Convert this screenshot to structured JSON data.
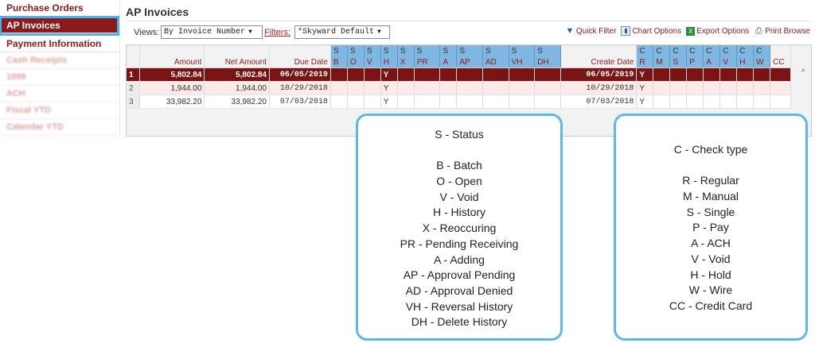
{
  "sidebar": {
    "items": [
      {
        "label": "Purchase Orders",
        "state": "normal"
      },
      {
        "label": "AP Invoices",
        "state": "active"
      },
      {
        "label": "Payment Information",
        "state": "normal"
      },
      {
        "label": "Cash Receipts",
        "state": "blurred"
      },
      {
        "label": "1099",
        "state": "blurred"
      },
      {
        "label": "ACH",
        "state": "blurred"
      },
      {
        "label": "Fiscal YTD",
        "state": "blurred"
      },
      {
        "label": "Calendar YTD",
        "state": "blurred"
      }
    ]
  },
  "page": {
    "title": "AP Invoices"
  },
  "toolbar": {
    "views_label": "Views:",
    "views_value": "By Invoice Number",
    "filters_label": "Filters:",
    "filters_value": "*Skyward Default",
    "quick_filter": "Quick Filter",
    "chart_options": "Chart Options",
    "export_options": "Export Options",
    "print_browse": "Print Browse"
  },
  "grid": {
    "columns": {
      "amount": "Amount",
      "net_amount": "Net Amount",
      "due_date": "Due Date",
      "create_date": "Create Date",
      "status_group": [
        "S",
        "S",
        "S",
        "S",
        "S",
        "S",
        "S",
        "S",
        "S",
        "S",
        "S"
      ],
      "status_codes": [
        "B",
        "O",
        "V",
        "H",
        "X",
        "PR",
        "A",
        "AP",
        "AD",
        "VH",
        "DH"
      ],
      "check_group": [
        "C",
        "C",
        "C",
        "C",
        "C",
        "C",
        "C",
        "C"
      ],
      "check_codes": [
        "R",
        "M",
        "S",
        "P",
        "A",
        "V",
        "H",
        "W",
        "CC"
      ]
    },
    "rows": [
      {
        "num": "1",
        "amount": "5,802.84",
        "net": "5,802.84",
        "due": "06/05/2019",
        "h": "Y",
        "create": "06/05/2019",
        "r": "Y"
      },
      {
        "num": "2",
        "amount": "1,944.00",
        "net": "1,944.00",
        "due": "10/29/2018",
        "h": "Y",
        "create": "10/29/2018",
        "r": "Y"
      },
      {
        "num": "3",
        "amount": "33,982.20",
        "net": "33,982.20",
        "due": "07/03/2018",
        "h": "Y",
        "create": "07/03/2018",
        "r": "Y"
      }
    ]
  },
  "status_legend": {
    "title": "S - Status",
    "items": [
      "B - Batch",
      "O - Open",
      "V - Void",
      "H - History",
      "X - Reoccuring",
      "PR - Pending Receiving",
      "A - Adding",
      "AP - Approval Pending",
      "AD - Approval Denied",
      "VH - Reversal History",
      "DH - Delete History"
    ]
  },
  "check_legend": {
    "title": "C - Check type",
    "items": [
      "R - Regular",
      "M - Manual",
      "S - Single",
      "P - Pay",
      "A - ACH",
      "V - Void",
      "H - Hold",
      "W - Wire",
      "CC - Credit Card"
    ]
  },
  "colors": {
    "brand": "#8b1a1a",
    "accent": "#5bb8ec",
    "selected_row": "#7a1414",
    "header_highlight": "#7fb7e0"
  }
}
